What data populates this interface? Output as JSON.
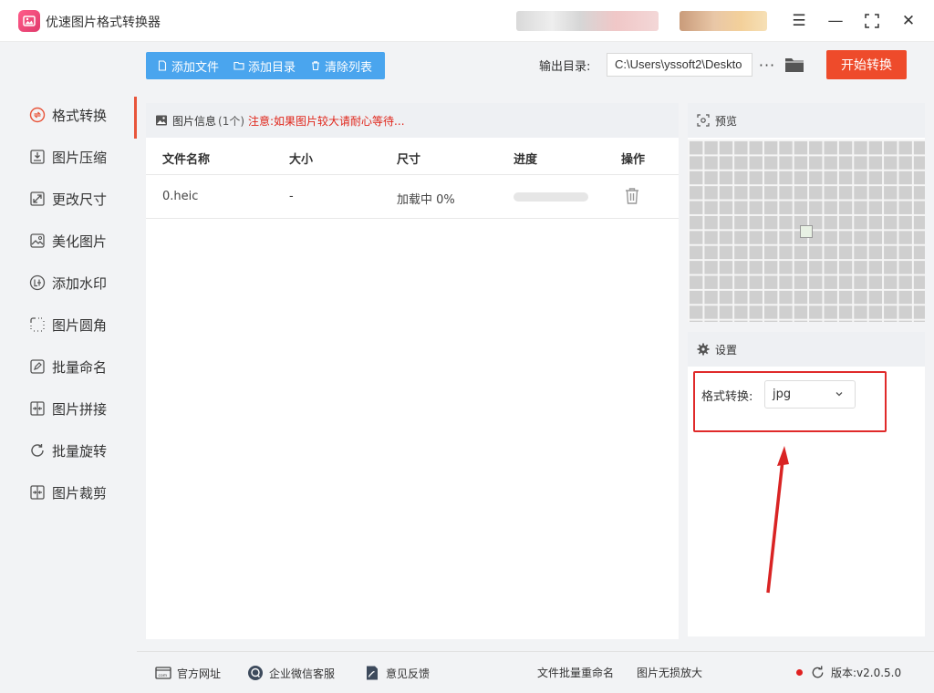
{
  "app": {
    "title": "优速图片格式转换器"
  },
  "sidebar": {
    "items": [
      {
        "label": "格式转换",
        "icon": "format-convert-icon",
        "active": true
      },
      {
        "label": "图片压缩",
        "icon": "compress-icon"
      },
      {
        "label": "更改尺寸",
        "icon": "resize-icon"
      },
      {
        "label": "美化图片",
        "icon": "beautify-icon"
      },
      {
        "label": "添加水印",
        "icon": "watermark-icon"
      },
      {
        "label": "图片圆角",
        "icon": "rounded-corner-icon"
      },
      {
        "label": "批量命名",
        "icon": "rename-icon"
      },
      {
        "label": "图片拼接",
        "icon": "stitch-icon"
      },
      {
        "label": "批量旋转",
        "icon": "rotate-icon"
      },
      {
        "label": "图片裁剪",
        "icon": "crop-icon"
      }
    ]
  },
  "toolbar": {
    "add_file": "添加文件",
    "add_folder": "添加目录",
    "clear_list": "清除列表",
    "output_label": "输出目录:",
    "output_path": "C:\\Users\\yssoft2\\Deskto",
    "more": "···",
    "start": "开始转换",
    "accent": "#4aa5ee",
    "start_color": "#ee4b2b"
  },
  "file_panel": {
    "title": "图片信息",
    "count": "(1个)",
    "note": "注意:如果图片较大请耐心等待...",
    "columns": [
      "文件名称",
      "大小",
      "尺寸",
      "进度",
      "操作"
    ],
    "rows": [
      {
        "name": "0.heic",
        "size": "-",
        "dims": "加载中 0%",
        "progress": 0
      }
    ]
  },
  "preview": {
    "title": "预览"
  },
  "settings": {
    "title": "设置",
    "format_label": "格式转换:",
    "format_value": "jpg"
  },
  "footer": {
    "website": "官方网址",
    "wechat": "企业微信客服",
    "feedback": "意见反馈",
    "batch_rename": "文件批量重命名",
    "upscale": "图片无损放大",
    "version": "版本:v2.0.5.0"
  }
}
